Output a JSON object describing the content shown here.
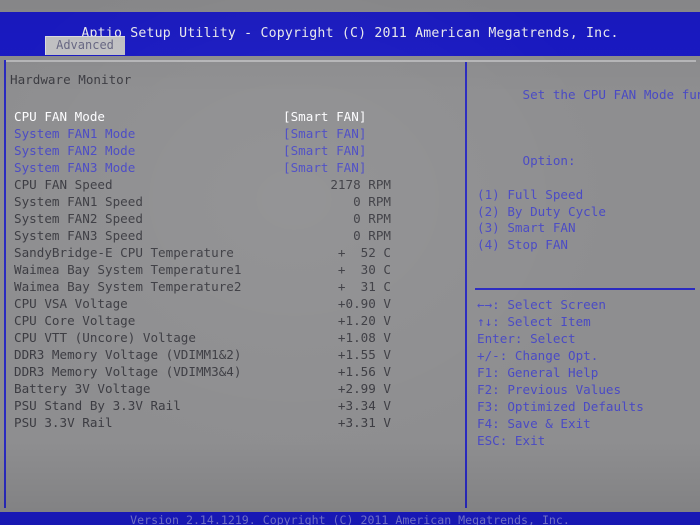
{
  "header": {
    "title": "Aptio Setup Utility - Copyright (C) 2011 American Megatrends, Inc."
  },
  "tabs": [
    {
      "label": "Advanced",
      "active": true
    }
  ],
  "main": {
    "section_title": "Hardware Monitor",
    "rows": [
      {
        "label": "CPU FAN Mode",
        "value": "[Smart FAN]",
        "kind": "selected"
      },
      {
        "label": "System FAN1 Mode",
        "value": "[Smart FAN]",
        "kind": "option"
      },
      {
        "label": "System FAN2 Mode",
        "value": "[Smart FAN]",
        "kind": "option"
      },
      {
        "label": "System FAN3 Mode",
        "value": "[Smart FAN]",
        "kind": "option"
      },
      {
        "label": "CPU FAN Speed",
        "value": "2178 RPM",
        "kind": "readonly"
      },
      {
        "label": "System FAN1 Speed",
        "value": "0 RPM",
        "kind": "readonly"
      },
      {
        "label": "System FAN2 Speed",
        "value": "0 RPM",
        "kind": "readonly"
      },
      {
        "label": "System FAN3 Speed",
        "value": "0 RPM",
        "kind": "readonly"
      },
      {
        "label": "SandyBridge-E CPU Temperature",
        "value": "+  52 C",
        "kind": "readonly"
      },
      {
        "label": "Waimea Bay System Temperature1",
        "value": "+  30 C",
        "kind": "readonly"
      },
      {
        "label": "Waimea Bay System Temperature2",
        "value": "+  31 C",
        "kind": "readonly"
      },
      {
        "label": "CPU VSA Voltage",
        "value": "+0.90 V",
        "kind": "readonly"
      },
      {
        "label": "CPU Core Voltage",
        "value": "+1.20 V",
        "kind": "readonly"
      },
      {
        "label": "CPU VTT (Uncore) Voltage",
        "value": "+1.08 V",
        "kind": "readonly"
      },
      {
        "label": "DDR3 Memory Voltage (VDIMM1&2)",
        "value": "+1.55 V",
        "kind": "readonly"
      },
      {
        "label": "DDR3 Memory Voltage (VDIMM3&4)",
        "value": "+1.56 V",
        "kind": "readonly"
      },
      {
        "label": "Battery 3V Voltage",
        "value": "+2.99 V",
        "kind": "readonly"
      },
      {
        "label": "PSU Stand By 3.3V Rail",
        "value": "+3.34 V",
        "kind": "readonly"
      },
      {
        "label": "PSU 3.3V Rail",
        "value": "+3.31 V",
        "kind": "readonly"
      }
    ]
  },
  "help": {
    "description": "Set the CPU FAN Mode function.",
    "options_label": "Option:",
    "options": [
      "(1) Full Speed",
      "(2) By Duty Cycle",
      "(3) Smart FAN",
      "(4) Stop FAN"
    ]
  },
  "keys": [
    {
      "key": "←→",
      "action": ": Select Screen"
    },
    {
      "key": "↑↓",
      "action": ": Select Item"
    },
    {
      "key": "Enter",
      "action": ": Select"
    },
    {
      "key": "+/-",
      "action": ": Change Opt."
    },
    {
      "key": "F1",
      "action": ": General Help"
    },
    {
      "key": "F2",
      "action": ": Previous Values"
    },
    {
      "key": "F3",
      "action": ": Optimized Defaults"
    },
    {
      "key": "F4",
      "action": ": Save & Exit"
    },
    {
      "key": "ESC",
      "action": ": Exit"
    }
  ],
  "footer": {
    "text": "Version 2.14.1219. Copyright (C) 2011 American Megatrends, Inc."
  },
  "colors": {
    "band_blue": "#1a1ac6",
    "text_blue": "#4a4ac4",
    "background_gray": "#8e8e90",
    "readonly_text": "#3c3c42",
    "selected_text": "#fdfdff"
  }
}
